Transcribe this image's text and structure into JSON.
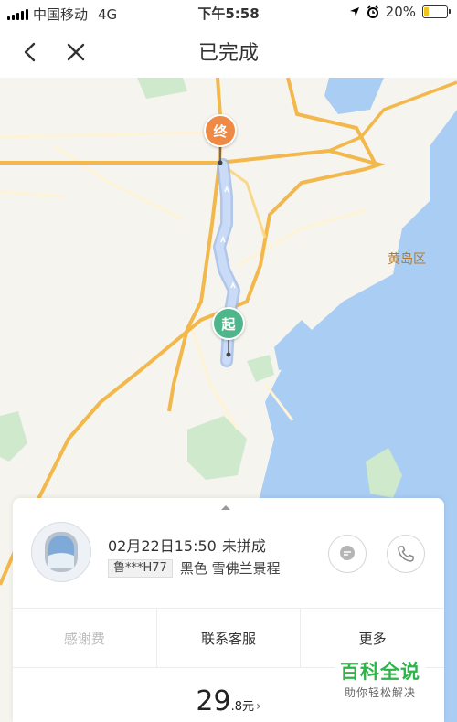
{
  "status_bar": {
    "carrier": "中国移动",
    "network": "4G",
    "time": "下午5:58",
    "battery": "20%",
    "battery_level": 0.2
  },
  "nav": {
    "title": "已完成",
    "back_icon": "chevron-left-icon",
    "close_icon": "close-icon"
  },
  "map": {
    "start_marker": "起",
    "end_marker": "终",
    "place_label": "黄岛区",
    "colors": {
      "land": "#f6f4ee",
      "water": "#a9cdf3",
      "green": "#cfe9cc",
      "road": "#f2b84b",
      "route": "#c2d5f3",
      "start_marker": "#4fb68b",
      "end_marker": "#ee8a45"
    }
  },
  "order": {
    "datetime": "02月22日15:50",
    "pool_status": "未拼成",
    "plate": "鲁***H77",
    "car_description": "黑色 雪佛兰景程",
    "message_icon": "message-icon",
    "phone_icon": "phone-icon"
  },
  "actions": [
    {
      "label": "感谢费",
      "enabled": false
    },
    {
      "label": "联系客服",
      "enabled": true
    },
    {
      "label": "更多",
      "enabled": true
    }
  ],
  "fare": {
    "integer": "29",
    "decimal": ".8元"
  },
  "watermark": {
    "title": "百科全说",
    "subtitle": "助你轻松解决"
  }
}
